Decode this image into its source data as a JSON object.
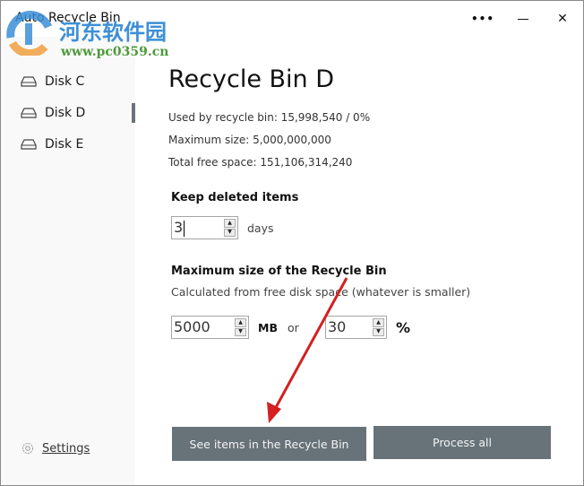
{
  "window": {
    "title": "Auto Recycle Bin",
    "controls": {
      "more": "•••",
      "minimize": "minimize",
      "close": "✕"
    }
  },
  "sidebar": {
    "items": [
      {
        "label": "Disk C",
        "icon": "disk-drive-icon",
        "active": false
      },
      {
        "label": "Disk D",
        "icon": "disk-drive-icon",
        "active": true
      },
      {
        "label": "Disk E",
        "icon": "disk-drive-icon",
        "active": false
      }
    ],
    "settings": {
      "label": "Settings",
      "icon": "gear-icon"
    }
  },
  "main": {
    "heading": "Recycle Bin D",
    "info": {
      "used": "Used by recycle bin: 15,998,540 / 0%",
      "max_size": "Maximum size: 5,000,000,000",
      "free_space": "Total free space: 151,106,314,240"
    },
    "keep": {
      "title": "Keep deleted items",
      "value": "3",
      "unit": "days"
    },
    "max_size_section": {
      "title": "Maximum size of the Recycle Bin",
      "subtitle": "Calculated from free disk space (whatever is smaller)",
      "mb_value": "5000",
      "mb_unit": "MB",
      "or_label": "or",
      "percent_value": "30",
      "percent_unit": "%"
    },
    "buttons": {
      "see_items": "See items in the Recycle Bin",
      "process_all": "Process all"
    }
  },
  "overlay": {
    "watermark_cn": "河东软件园",
    "watermark_url": "www.pc0359.cn",
    "arrow_color": "#d42020"
  }
}
